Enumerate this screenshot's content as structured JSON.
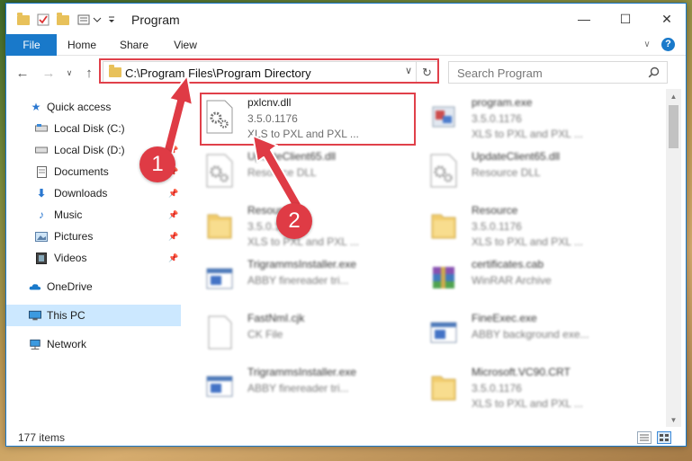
{
  "window": {
    "title": "Program",
    "controls": {
      "minimize": "—",
      "maximize": "☐",
      "close": "✕"
    }
  },
  "ribbon": {
    "tabs": [
      {
        "label": "File"
      },
      {
        "label": "Home"
      },
      {
        "label": "Share"
      },
      {
        "label": "View"
      }
    ],
    "help_label": "?"
  },
  "nav": {
    "address_path": "C:\\Program Files\\Program Directory",
    "search_placeholder": "Search Program"
  },
  "sidebar": {
    "items": [
      {
        "label": "Quick access",
        "icon": "star-icon"
      },
      {
        "label": "Local Disk (C:)",
        "icon": "drive-icon"
      },
      {
        "label": "Local Disk (D:)",
        "icon": "drive-icon"
      },
      {
        "label": "Documents",
        "icon": "documents-icon"
      },
      {
        "label": "Downloads",
        "icon": "download-icon"
      },
      {
        "label": "Music",
        "icon": "music-icon"
      },
      {
        "label": "Pictures",
        "icon": "pictures-icon"
      },
      {
        "label": "Videos",
        "icon": "videos-icon"
      },
      {
        "label": "OneDrive",
        "icon": "cloud-icon"
      },
      {
        "label": "This PC",
        "icon": "computer-icon"
      },
      {
        "label": "Network",
        "icon": "network-icon"
      }
    ]
  },
  "files": [
    {
      "name": "pxlcnv.dll",
      "line2": "3.5.0.1176",
      "line3": "XLS to PXL and PXL ...",
      "icon": "dll-gear-icon"
    },
    {
      "name": "program.exe",
      "line2": "3.5.0.1176",
      "line3": "XLS to PXL and PXL ...",
      "icon": "exe-icon"
    },
    {
      "name": "UpdateClient65.dll",
      "line2": "Resource DLL",
      "line3": "",
      "icon": "dll-gear-icon"
    },
    {
      "name": "UpdateClient65.dll",
      "line2": "Resource DLL",
      "line3": "",
      "icon": "dll-gear-icon"
    },
    {
      "name": "Resource",
      "line2": "3.5.0.1176",
      "line3": "XLS to PXL and PXL ...",
      "icon": "folder-icon"
    },
    {
      "name": "Resource",
      "line2": "3.5.0.1176",
      "line3": "XLS to PXL and PXL ...",
      "icon": "folder-icon"
    },
    {
      "name": "TrigrammsInstaller.exe",
      "line2": "ABBY finereader tri...",
      "line3": "",
      "icon": "installer-icon"
    },
    {
      "name": "certificates.cab",
      "line2": "WinRAR Archive",
      "line3": "",
      "icon": "archive-icon"
    },
    {
      "name": "FastNmI.cjk",
      "line2": "CK File",
      "line3": "",
      "icon": "blank-file-icon"
    },
    {
      "name": "FineExec.exe",
      "line2": "ABBY background exe...",
      "line3": "",
      "icon": "installer-icon"
    },
    {
      "name": "TrigrammsInstaller.exe",
      "line2": "ABBY finereader tri...",
      "line3": "",
      "icon": "installer-icon"
    },
    {
      "name": "Microsoft.VC90.CRT",
      "line2": "3.5.0.1176",
      "line3": "XLS to PXL and PXL ...",
      "icon": "folder-icon"
    }
  ],
  "status": {
    "item_count": "177 items"
  },
  "annotations": {
    "step1": "1",
    "step2": "2"
  },
  "colors": {
    "accent": "#1979ca",
    "highlight": "#e0404a",
    "selected": "#cce8ff"
  }
}
